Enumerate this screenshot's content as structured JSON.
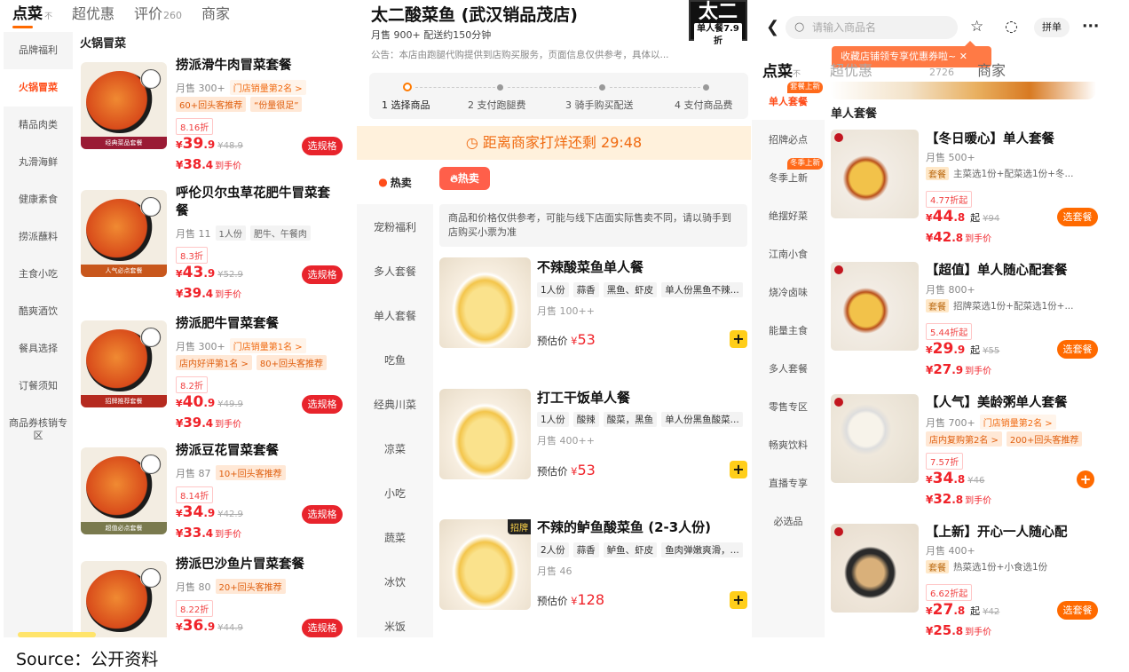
{
  "left": {
    "tabs": {
      "diancai": "点菜",
      "diancai_sub": "不",
      "chaoyouhui": "超优惠",
      "pingjia": "评价",
      "pingjia_count": "260",
      "shangjia": "商家"
    },
    "sidebar": [
      "品牌福利",
      "火锅冒菜",
      "精品肉类",
      "丸滑海鲜",
      "健康素食",
      "捞派蘸料",
      "主食小吃",
      "酷爽酒饮",
      "餐具选择",
      "订餐须知",
      "商品券核销专区"
    ],
    "section_title": "火锅冒菜",
    "items": [
      {
        "name": "捞派滑牛肉冒菜套餐",
        "sale": "月售 300+",
        "chips": [
          "门店销量第2名 >"
        ],
        "chips2": [
          "60+回头客推荐",
          "“份量很足”"
        ],
        "discount": "8.16折",
        "price_int": "39",
        "price_dec": ".9",
        "old": "¥48.9",
        "hand_int": "38",
        "hand_dec": ".4",
        "band": "经典菜品套餐"
      },
      {
        "name": "呼伦贝尔虫草花肥牛冒菜套餐",
        "sale": "月售 11",
        "chips": [
          "1人份",
          "肥牛、午餐肉"
        ],
        "chips2": [],
        "discount": "8.3折",
        "price_int": "43",
        "price_dec": ".9",
        "old": "¥52.9",
        "hand_int": "39",
        "hand_dec": ".4",
        "band": "人气必点套餐"
      },
      {
        "name": "捞派肥牛冒菜套餐",
        "sale": "月售 300+",
        "chips": [
          "门店销量第1名 >"
        ],
        "chips2": [
          "店内好评第1名 >",
          "80+回头客推荐"
        ],
        "discount": "8.2折",
        "price_int": "40",
        "price_dec": ".9",
        "old": "¥49.9",
        "hand_int": "39",
        "hand_dec": ".4",
        "band": "招牌推荐套餐"
      },
      {
        "name": "捞派豆花冒菜套餐",
        "sale": "月售 87",
        "chips": [
          "10+回头客推荐"
        ],
        "chips2": [],
        "discount": "8.14折",
        "price_int": "34",
        "price_dec": ".9",
        "old": "¥42.9",
        "hand_int": "33",
        "hand_dec": ".4",
        "band": "超值必点套餐"
      },
      {
        "name": "捞派巴沙鱼片冒菜套餐",
        "sale": "月售 80",
        "chips": [
          "20+回头客推荐"
        ],
        "chips2": [],
        "discount": "8.22折",
        "price_int": "36",
        "price_dec": ".9",
        "old": "¥44.9",
        "hand_int": "",
        "hand_dec": "",
        "band": ""
      }
    ],
    "select_spec": "选规格",
    "hand_label": "到手价"
  },
  "middle": {
    "shop_title": "太二酸菜鱼 (武汉销品茂店)",
    "shop_meta": "月售 900+   配送约150分钟",
    "notice": "公告：本店由跑腿代购提供到店购买服务，页面信息仅供参考，具体以...",
    "logo_text": "太二",
    "logo_sub": "单人餐7.9折",
    "steps": [
      "1 选择商品",
      "2 支付跑腿费",
      "3 骑手购买配送",
      "4 支付商品费"
    ],
    "countdown": "◷ 距离商家打烊还剩 29:48",
    "side": [
      "热卖",
      "宠粉福利",
      "多人套餐",
      "单人套餐",
      "吃鱼",
      "经典川菜",
      "凉菜",
      "小吃",
      "蔬菜",
      "冰饮",
      "米饭"
    ],
    "hot_pill": "热卖",
    "disclaimer": "商品和价格仅供参考，可能与线下店面实际售卖不同，请以骑手到店购买小票为准",
    "fish": [
      {
        "name": "不辣酸菜鱼单人餐",
        "tags": [
          "1人份",
          "蒜香",
          "黑鱼、虾皮",
          "单人份黑鱼不辣..."
        ],
        "sale": "月售 100++",
        "price": "53",
        "badge": ""
      },
      {
        "name": "打工干饭单人餐",
        "tags": [
          "1人份",
          "酸辣",
          "酸菜，黑鱼",
          "单人份黑鱼酸菜..."
        ],
        "sale": "月售 400++",
        "price": "53",
        "badge": ""
      },
      {
        "name": "不辣的鲈鱼酸菜鱼 (2-3人份)",
        "tags": [
          "2人份",
          "蒜香",
          "鲈鱼、虾皮",
          "鱼肉弹嫩爽滑，..."
        ],
        "sale": "月售 46",
        "price": "128",
        "badge": "招牌"
      }
    ],
    "est_label": "预估价",
    "yen": "¥"
  },
  "right": {
    "search_placeholder": "请输入商品名",
    "pin": "拼单",
    "toast": "收藏店铺领专享优惠券啦~  ✕",
    "tabs": {
      "diancai": "点菜",
      "diancai_sub": "不",
      "chaoyouhui": "超优惠",
      "pingjia": "评价",
      "pingjia_count": "2726",
      "shangjia": "商家"
    },
    "side": [
      {
        "label": "单人套餐",
        "mini": "套餐上新"
      },
      {
        "label": "招牌必点",
        "mini": ""
      },
      {
        "label": "冬季上新",
        "mini": "冬季上新"
      },
      {
        "label": "绝摆好菜",
        "mini": ""
      },
      {
        "label": "江南小食",
        "mini": ""
      },
      {
        "label": "烧冷卤味",
        "mini": ""
      },
      {
        "label": "能量主食",
        "mini": ""
      },
      {
        "label": "多人套餐",
        "mini": ""
      },
      {
        "label": "零售专区",
        "mini": ""
      },
      {
        "label": "畅爽饮料",
        "mini": ""
      },
      {
        "label": "直播专享",
        "mini": ""
      },
      {
        "label": "必选品",
        "mini": ""
      }
    ],
    "section_title": "单人套餐",
    "sets": [
      {
        "name": "【冬日暖心】单人套餐",
        "sale": "月售 500+",
        "chips": [],
        "desc_k": "套餐",
        "desc": "主菜选1份+配菜选1份+冬...",
        "discount": "4.77折起",
        "price_int": "44",
        "price_dec": ".8",
        "old": "¥94",
        "hand_int": "42",
        "hand_dec": ".8",
        "btn": "选套餐"
      },
      {
        "name": "【超值】单人随心配套餐",
        "sale": "月售 800+",
        "chips": [],
        "desc_k": "套餐",
        "desc": "招牌菜选1份+配菜选1份+...",
        "discount": "5.44折起",
        "price_int": "29",
        "price_dec": ".9",
        "old": "¥55",
        "hand_int": "27",
        "hand_dec": ".9",
        "btn": "选套餐"
      },
      {
        "name": "【人气】美龄粥单人套餐",
        "sale": "月售 700+",
        "chips": [
          "门店销量第2名 >"
        ],
        "desc_k": "",
        "desc": "",
        "chips2": [
          "店内复购第2名 >",
          "200+回头客推荐"
        ],
        "discount": "7.57折",
        "price_int": "34",
        "price_dec": ".8",
        "old": "¥46",
        "hand_int": "32",
        "hand_dec": ".8",
        "btn": "+"
      },
      {
        "name": "【上新】开心一人随心配",
        "sale": "月售 400+",
        "chips": [],
        "desc_k": "套餐",
        "desc": "热菜选1份+小食选1份",
        "discount": "6.62折起",
        "price_int": "27",
        "price_dec": ".8",
        "old": "¥42",
        "hand_int": "25",
        "hand_dec": ".8",
        "btn": "选套餐"
      }
    ],
    "qi": "起"
  },
  "source": "Source：公开资料"
}
